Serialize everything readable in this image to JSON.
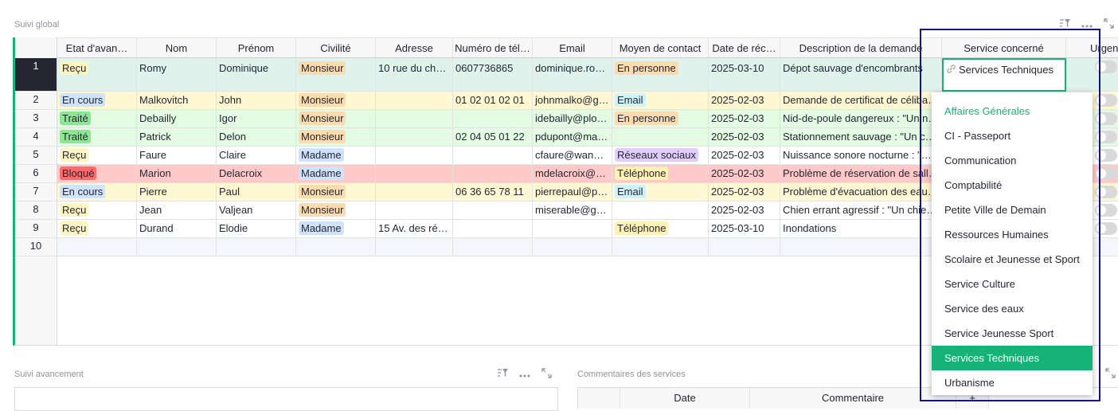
{
  "suivi_global": {
    "title": "Suivi global",
    "columns": [
      "Etat d'avan…",
      "Nom",
      "Prénom",
      "Civilité",
      "Adresse",
      "Numéro de tél…",
      "Email",
      "Moyen de contact",
      "Date de réc…",
      "Description de la demande",
      "Service concerné",
      "Urgent"
    ],
    "rows": [
      {
        "n": "1",
        "etat": "Reçu",
        "nom": "Romy",
        "prenom": "Dominique",
        "civ": "Monsieur",
        "adresse": "10 rue du ch…",
        "tel": "0607736865",
        "email": "dominique.ro…",
        "moyen": "En personne",
        "date": "2025-03-10",
        "desc": "Dépot sauvage d'encombrants",
        "service": "Services Techniques"
      },
      {
        "n": "2",
        "etat": "En cours",
        "nom": "Malkovitch",
        "prenom": "John",
        "civ": "Monsieur",
        "adresse": "",
        "tel": "01 02 01 02 01",
        "email": "johnmalko@g…",
        "moyen": "Email",
        "date": "2025-02-03",
        "desc": "Demande de certificat de céliba…",
        "service": ""
      },
      {
        "n": "3",
        "etat": "Traité",
        "nom": "Debailly",
        "prenom": "Igor",
        "civ": "Monsieur",
        "adresse": "",
        "tel": "",
        "email": "idebailly@plo…",
        "moyen": "En personne",
        "date": "2025-02-03",
        "desc": "Nid-de-poule dangereux : \"Un n…",
        "service": ""
      },
      {
        "n": "4",
        "etat": "Traité",
        "nom": "Patrick",
        "prenom": "Delon",
        "civ": "Monsieur",
        "adresse": "",
        "tel": "02 04 05 01 22",
        "email": "pdupont@ma…",
        "moyen": "",
        "date": "2025-02-03",
        "desc": "Stationnement sauvage : \"Un c…",
        "service": ""
      },
      {
        "n": "5",
        "etat": "Reçu",
        "nom": "Faure",
        "prenom": "Claire",
        "civ": "Madame",
        "adresse": "",
        "tel": "",
        "email": "cfaure@wan…",
        "moyen": "Réseaux sociaux",
        "date": "2025-02-03",
        "desc": "Nuissance sonore nocturne : \"D…",
        "service": ""
      },
      {
        "n": "6",
        "etat": "Bloqué",
        "nom": "Marion",
        "prenom": "Delacroix",
        "civ": "Madame",
        "adresse": "",
        "tel": "",
        "email": "mdelacroix@…",
        "moyen": "Téléphone",
        "date": "2025-02-03",
        "desc": "Problème de réservation de sall…",
        "service": ""
      },
      {
        "n": "7",
        "etat": "En cours",
        "nom": "Pierre",
        "prenom": "Paul",
        "civ": "Monsieur",
        "adresse": "",
        "tel": "06 36 65 78 11",
        "email": "pierrepaul@p…",
        "moyen": "Email",
        "date": "2025-02-03",
        "desc": "Problème d'évacuation des eau…",
        "service": ""
      },
      {
        "n": "8",
        "etat": "Reçu",
        "nom": "Jean",
        "prenom": "Valjean",
        "civ": "Monsieur",
        "adresse": "",
        "tel": "",
        "email": "miserable@g…",
        "moyen": "",
        "date": "2025-02-03",
        "desc": "Chien errant agressif : \"Un chie…",
        "service": ""
      },
      {
        "n": "9",
        "etat": "Reçu",
        "nom": "Durand",
        "prenom": "Elodie",
        "civ": "Madame",
        "adresse": "15 Av. des ré…",
        "tel": "",
        "email": "",
        "moyen": "Téléphone",
        "date": "2025-03-10",
        "desc": "Inondations",
        "service": ""
      },
      {
        "n": "10",
        "etat": "",
        "nom": "",
        "prenom": "",
        "civ": "",
        "adresse": "",
        "tel": "",
        "email": "",
        "moyen": "",
        "date": "",
        "desc": "",
        "service": ""
      }
    ]
  },
  "status_colors": {
    "Reçu": "#fef6c2",
    "En cours": "#cfe4fc",
    "Traité": "#8ee695",
    "Bloqué": "#ff6b6b"
  },
  "row_colors": {
    "Reçu": "#ffffff",
    "En cours": "#fff8d2",
    "Traité": "#e3fbe3",
    "Bloqué": "#ffc9c9",
    "": "#f5f6fc"
  },
  "civ_colors": {
    "Monsieur": "#fbdcb0",
    "Madame": "#cfe4fc"
  },
  "moyen_colors": {
    "En personne": "#fbdcb0",
    "Email": "#cff3fc",
    "Réseaux sociaux": "#e1cdf9",
    "Téléphone": "#fff2b5"
  },
  "dropdown": {
    "items": [
      "Affaires Générales",
      "CI - Passeport",
      "Communication",
      "Comptabilité",
      "Petite Ville de Demain",
      "Ressources Humaines",
      "Scolaire et Jeunesse et Sport",
      "Service Culture",
      "Service des eaux",
      "Service Jeunesse Sport",
      "Services Techniques",
      "Urbanisme"
    ],
    "highlighted": "Affaires Générales",
    "selected": "Services Techniques",
    "accent": "#16b378"
  },
  "suivi_avancement": {
    "title": "Suivi avancement"
  },
  "commentaires": {
    "title": "Commentaires des services",
    "columns": [
      "Date",
      "Commentaire"
    ],
    "add": "+"
  },
  "icons": [
    "filter-sort-icon",
    "more-icon",
    "expand-icon",
    "link-icon"
  ]
}
